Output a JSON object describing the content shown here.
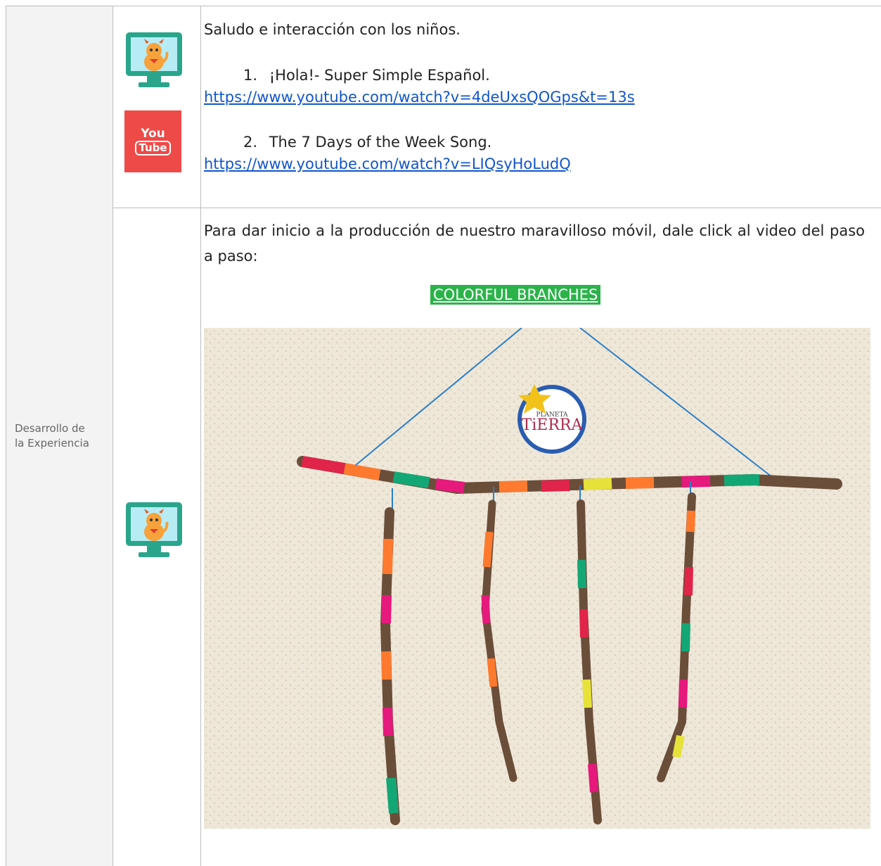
{
  "sidebar": {
    "label_line1": "Desarrollo de",
    "label_line2": "la Experiencia"
  },
  "row1": {
    "intro": "Saludo e interacción con los niños.",
    "items": [
      {
        "number": "1.",
        "title": "¡Hola!- Super Simple Español.",
        "url": "https://www.youtube.com/watch?v=4deUxsQOGps&t=13s"
      },
      {
        "number": "2.",
        "title": "The 7 Days of the Week Song.",
        "url": "https://www.youtube.com/watch?v=LIQsyHoLudQ"
      }
    ],
    "youtube_icon": {
      "you": "You",
      "tube": "Tube"
    }
  },
  "row2": {
    "paragraph": "Para dar inicio a la producción de nuestro maravilloso móvil, dale click al video del paso a paso:",
    "cta": " COLORFUL BRANCHES",
    "photo_badge": {
      "top": "PLANETA",
      "word": "TiERRA"
    }
  },
  "colors": {
    "link": "#1155cc",
    "youtube_red": "#ee4a47",
    "cta_green": "#2bb34a",
    "monitor_teal": "#2aa58c"
  }
}
